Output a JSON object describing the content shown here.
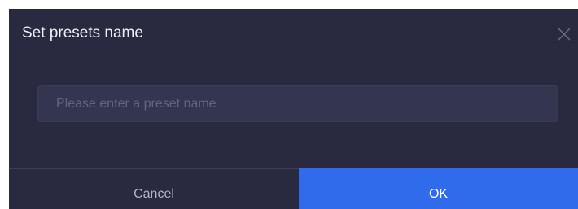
{
  "dialog": {
    "title": "Set presets name",
    "close_icon": "close-icon",
    "input": {
      "value": "",
      "placeholder": "Please enter a preset name"
    },
    "buttons": {
      "cancel_label": "Cancel",
      "ok_label": "OK"
    }
  },
  "colors": {
    "background": "#292a3f",
    "input_background": "#34354f",
    "accent": "#2f6bea",
    "title_text": "#eceef6",
    "placeholder_text": "#62647e"
  }
}
